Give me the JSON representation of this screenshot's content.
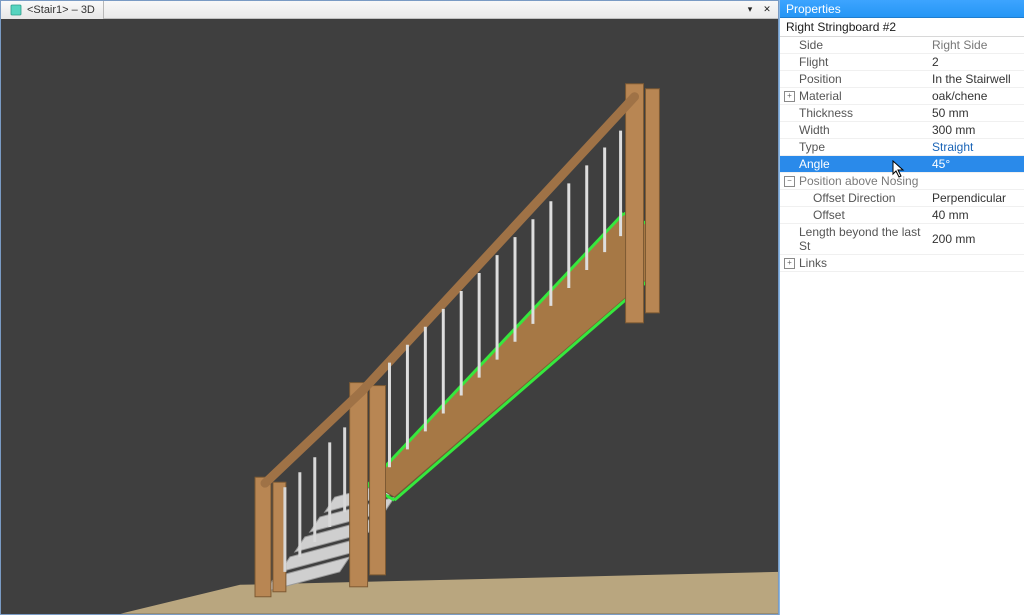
{
  "viewport": {
    "tab_title": "<Stair1> – 3D",
    "tab_dropdown_glyph": "▾",
    "tab_close_glyph": "✕"
  },
  "panel": {
    "header": "Properties",
    "object_name": "Right Stringboard #2"
  },
  "props": {
    "side": {
      "label": "Side",
      "value": "Right Side"
    },
    "flight": {
      "label": "Flight",
      "value": "2"
    },
    "position": {
      "label": "Position",
      "value": "In the Stairwell"
    },
    "material": {
      "label": "Material",
      "value": "oak/chene"
    },
    "thickness": {
      "label": "Thickness",
      "value": "50 mm"
    },
    "width": {
      "label": "Width",
      "value": "300 mm"
    },
    "type": {
      "label": "Type",
      "value": "Straight"
    },
    "angle": {
      "label": "Angle",
      "value": "45°"
    },
    "pos_above_nosing": {
      "label": "Position above Nosing"
    },
    "offset_dir": {
      "label": "Offset Direction",
      "value": "Perpendicular"
    },
    "offset": {
      "label": "Offset",
      "value": "40 mm"
    },
    "length_beyond": {
      "label": "Length beyond the last St",
      "value": "200 mm"
    },
    "links": {
      "label": "Links"
    }
  },
  "glyphs": {
    "plus": "+",
    "minus": "−"
  }
}
